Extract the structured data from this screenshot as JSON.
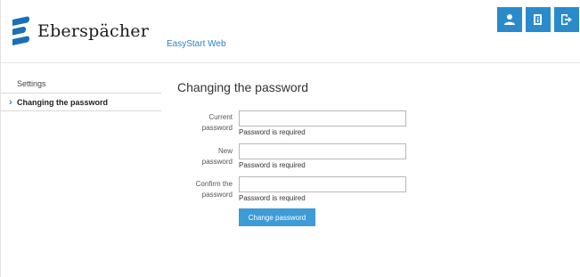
{
  "brand": {
    "logo_text": "Eberspächer"
  },
  "app": {
    "name": "EasyStart Web"
  },
  "header_buttons": [
    {
      "icon": "user-icon"
    },
    {
      "icon": "info-icon"
    },
    {
      "icon": "logout-icon"
    }
  ],
  "sidebar": {
    "items": [
      {
        "label": "Settings"
      },
      {
        "label": "Changing the password"
      }
    ]
  },
  "page": {
    "title": "Changing the password"
  },
  "form": {
    "current": {
      "label_1": "Current",
      "label_2": "password",
      "value": "",
      "error": "Password is required"
    },
    "new": {
      "label_1": "New",
      "label_2": "password",
      "value": "",
      "error": "Password is required"
    },
    "confirm": {
      "label_1": "Confirm the",
      "label_2": "password",
      "value": "",
      "error": "Password is required"
    },
    "submit_label": "Change password"
  },
  "colors": {
    "accent": "#2a8bcc",
    "button": "#3e9bd6",
    "link": "#2a83c3"
  }
}
